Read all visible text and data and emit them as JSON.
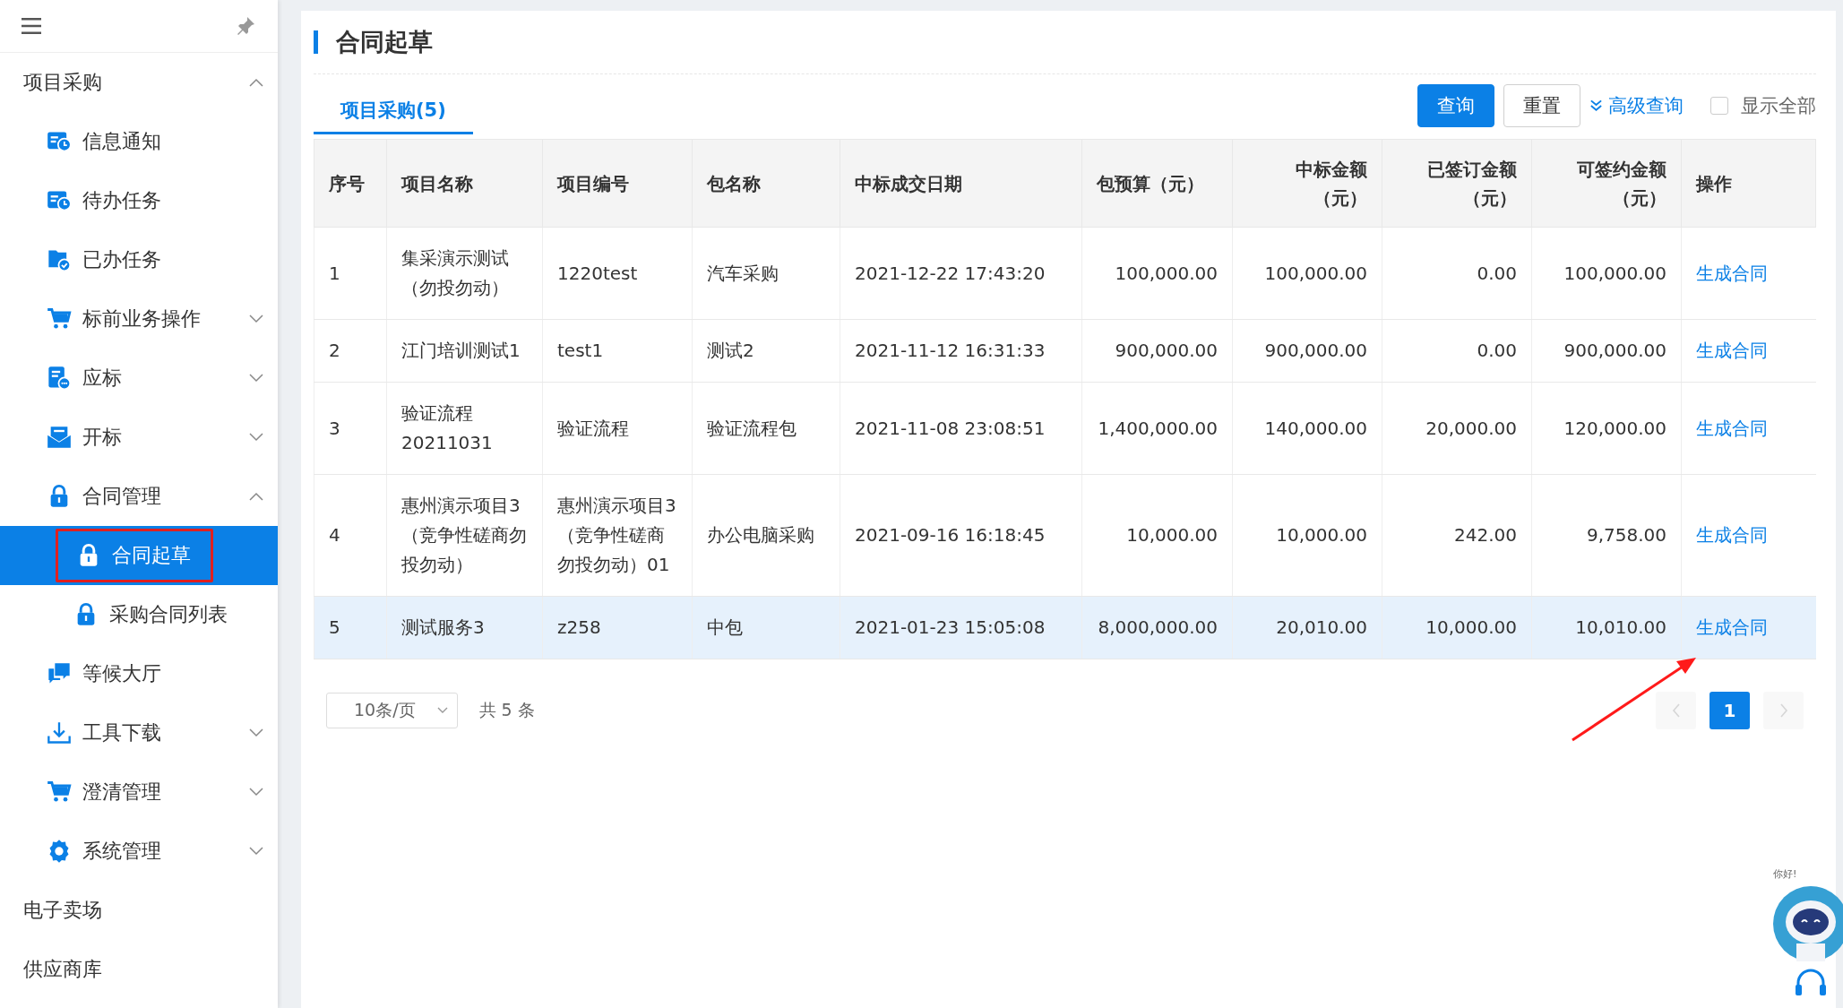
{
  "sidebar": {
    "items": [
      {
        "label": "项目采购",
        "expanded": true,
        "children": [
          {
            "label": "信息通知"
          },
          {
            "label": "待办任务"
          },
          {
            "label": "已办任务"
          },
          {
            "label": "标前业务操作",
            "expanded": false
          },
          {
            "label": "应标",
            "expanded": false
          },
          {
            "label": "开标",
            "expanded": false
          },
          {
            "label": "合同管理",
            "expanded": true,
            "children": [
              {
                "label": "合同起草",
                "selected": true,
                "annotated": true
              },
              {
                "label": "采购合同列表",
                "selected": false,
                "annotated": false
              }
            ]
          },
          {
            "label": "等候大厅"
          },
          {
            "label": "工具下载",
            "expanded": false
          },
          {
            "label": "澄清管理",
            "expanded": false
          },
          {
            "label": "系统管理",
            "expanded": false
          }
        ]
      },
      {
        "label": "电子卖场"
      },
      {
        "label": "供应商库"
      }
    ]
  },
  "page_title": "合同起草",
  "tabs": [
    {
      "label": "项目采购(5)",
      "selected": true
    }
  ],
  "toolbar": {
    "query_button": "查询",
    "reset_button": "重置",
    "advanced_link": "高级查询",
    "show_all": {
      "label": "显示全部",
      "checked": false
    }
  },
  "table": {
    "columns": [
      {
        "label": "序号"
      },
      {
        "label": "项目名称"
      },
      {
        "label": "项目编号"
      },
      {
        "label": "包名称"
      },
      {
        "label": "中标成交日期"
      },
      {
        "label": "包预算（元）"
      },
      {
        "label": "中标金额（元）"
      },
      {
        "label": "已签订金额（元）"
      },
      {
        "label": "可签约金额（元）"
      },
      {
        "label": "操作"
      }
    ],
    "rows": [
      {
        "selected": false,
        "cells": [
          "1",
          "集采演示测试（勿投勿动）",
          "1220test",
          "汽车采购",
          "2021-12-22 17:43:20",
          "100,000.00",
          "100,000.00",
          "0.00",
          "100,000.00"
        ],
        "action": "生成合同",
        "annotated": false
      },
      {
        "selected": false,
        "cells": [
          "2",
          "江门培训测试1",
          "test1",
          "测试2",
          "2021-11-12 16:31:33",
          "900,000.00",
          "900,000.00",
          "0.00",
          "900,000.00"
        ],
        "action": "生成合同",
        "annotated": false
      },
      {
        "selected": false,
        "cells": [
          "3",
          "验证流程20211031",
          "验证流程",
          "验证流程包",
          "2021-11-08 23:08:51",
          "1,400,000.00",
          "140,000.00",
          "20,000.00",
          "120,000.00"
        ],
        "action": "生成合同",
        "annotated": false
      },
      {
        "selected": false,
        "cells": [
          "4",
          "惠州演示项目3（竞争性磋商勿投勿动）",
          "惠州演示项目3（竞争性磋商勿投勿动）01",
          "办公电脑采购",
          "2021-09-16 16:18:45",
          "10,000.00",
          "10,000.00",
          "242.00",
          "9,758.00"
        ],
        "action": "生成合同",
        "annotated": false
      },
      {
        "selected": true,
        "cells": [
          "5",
          "测试服务3",
          "z258",
          "中包",
          "2021-01-23 15:05:08",
          "8,000,000.00",
          "20,010.00",
          "10,000.00",
          "10,010.00"
        ],
        "action": "生成合同",
        "annotated": true
      }
    ]
  },
  "pagination": {
    "page_size": "10条/页",
    "total": "共 5 条",
    "prev_disabled": true,
    "next_disabled": true,
    "pages": [
      {
        "label": "1",
        "selected": true
      }
    ]
  },
  "assistant": {
    "greeting": "你好!"
  }
}
